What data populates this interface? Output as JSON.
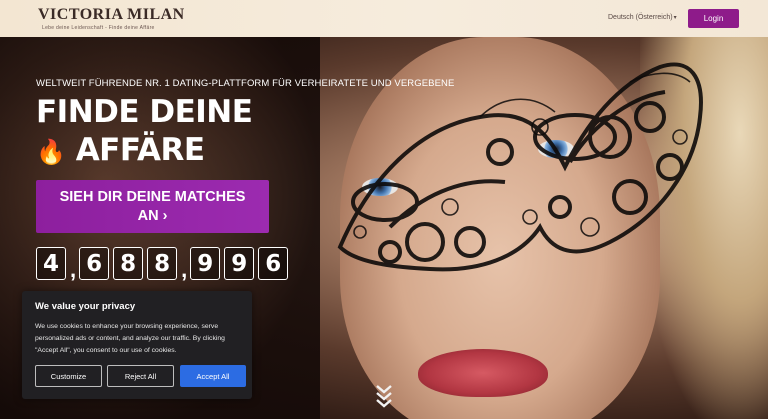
{
  "header": {
    "logo_text": "VICTORIA MILAN",
    "logo_sub": "Lebe deine Leidenschaft - Finde deine Affäre",
    "language": "Deutsch (Österreich)",
    "login_label": "Login"
  },
  "hero": {
    "tagline": "WELTWEIT FÜHRENDE NR. 1 DATING-PLATTFORM FÜR VERHEIRATETE UND VERGEBENE",
    "headline_line1": "FINDE DEINE",
    "headline_flame": "🔥",
    "headline_line2": "AFFÄRE",
    "cta_label": "SIEH DIR DEINE MATCHES AN ›",
    "counter": [
      "4",
      ",",
      "6",
      "8",
      "8",
      ",",
      "9",
      "9",
      "6"
    ]
  },
  "cookie_banner": {
    "title": "We value your privacy",
    "text": "We use cookies to enhance your browsing experience, serve personalized ads or content, and analyze our traffic. By clicking \"Accept All\", you consent to our use of cookies.",
    "customize_label": "Customize",
    "reject_label": "Reject All",
    "accept_label": "Accept All"
  },
  "colors": {
    "brand_purple": "#8e1b8a",
    "cta_purple": "#9c2bb0",
    "accept_blue": "#2c6ce3",
    "header_bg": "#f3e6d2"
  },
  "icons": [
    "flame-icon",
    "chevron-down-icon",
    "caret-down-icon"
  ]
}
